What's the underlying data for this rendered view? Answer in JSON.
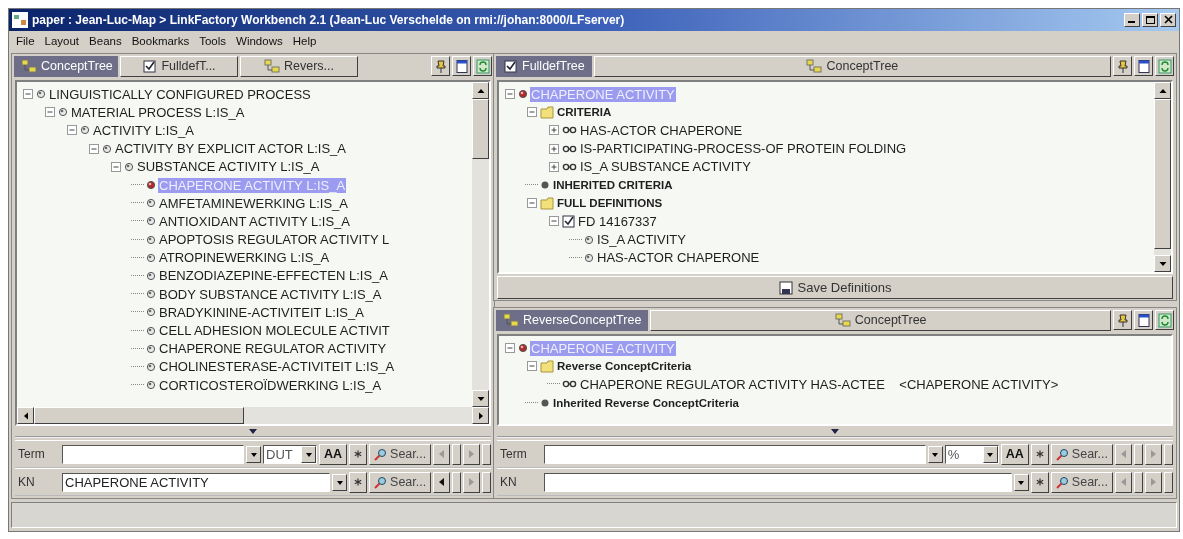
{
  "window": {
    "title": "paper : Jean-Luc-Map > LinkFactory Workbench 2.1 (Jean-Luc Verschelde on rmi://johan:8000/LFserver)"
  },
  "menu": [
    "File",
    "Layout",
    "Beans",
    "Bookmarks",
    "Tools",
    "Windows",
    "Help"
  ],
  "panels": [
    {
      "tabs": [
        {
          "label": "ConceptTree",
          "kind": "tree",
          "selected": true
        },
        {
          "label": "FulldefT...",
          "kind": "definition",
          "selected": false
        },
        {
          "label": "Revers...",
          "kind": "tree",
          "selected": false
        }
      ],
      "tree": [
        {
          "label": "LINGUISTICALLY CONFIGURED PROCESS",
          "kind": "concept",
          "selected": false,
          "expanded": true,
          "children": [
            {
              "label": "MATERIAL PROCESS L:IS_A",
              "kind": "concept",
              "selected": false,
              "expanded": true,
              "children": [
                {
                  "label": "ACTIVITY L:IS_A",
                  "kind": "concept",
                  "selected": false,
                  "expanded": true,
                  "children": [
                    {
                      "label": "ACTIVITY BY EXPLICIT ACTOR L:IS_A",
                      "kind": "concept",
                      "selected": false,
                      "expanded": true,
                      "children": [
                        {
                          "label": "SUBSTANCE ACTIVITY L:IS_A",
                          "kind": "concept",
                          "selected": false,
                          "expanded": true,
                          "children": [
                            {
                              "label": "CHAPERONE ACTIVITY L:IS_A",
                              "kind": "concept",
                              "selected": true
                            },
                            {
                              "label": "AMFETAMINEWERKING L:IS_A",
                              "kind": "concept",
                              "selected": false
                            },
                            {
                              "label": "ANTIOXIDANT ACTIVITY L:IS_A",
                              "kind": "concept",
                              "selected": false
                            },
                            {
                              "label": "APOPTOSIS REGULATOR ACTIVITY L",
                              "kind": "concept",
                              "selected": false
                            },
                            {
                              "label": "ATROPINEWERKING L:IS_A",
                              "kind": "concept",
                              "selected": false
                            },
                            {
                              "label": "BENZODIAZEPINE-EFFECTEN L:IS_A",
                              "kind": "concept",
                              "selected": false
                            },
                            {
                              "label": "BODY SUBSTANCE ACTIVITY L:IS_A",
                              "kind": "concept",
                              "selected": false
                            },
                            {
                              "label": "BRADYKININE-ACTIVITEIT L:IS_A",
                              "kind": "concept",
                              "selected": false
                            },
                            {
                              "label": "CELL ADHESION MOLECULE ACTIVIT",
                              "kind": "concept",
                              "selected": false
                            },
                            {
                              "label": "CHAPERONE REGULATOR ACTIVITY",
                              "kind": "concept",
                              "selected": false
                            },
                            {
                              "label": "CHOLINESTERASE-ACTIVITEIT L:IS_A",
                              "kind": "concept",
                              "selected": false
                            },
                            {
                              "label": "CORTICOSTEROÏDWERKING L:IS_A",
                              "kind": "concept",
                              "selected": false
                            }
                          ]
                        }
                      ]
                    }
                  ]
                }
              ]
            }
          ]
        }
      ],
      "search": [
        {
          "label": "Term",
          "language": "DUT",
          "case_button": "AA",
          "search_button": "Sear...",
          "back_enabled": false
        },
        {
          "label": "KN",
          "value": "CHAPERONE ACTIVITY",
          "search_button": "Sear...",
          "back_enabled": true
        }
      ]
    },
    {
      "tabs": [
        {
          "label": "FulldefTree",
          "kind": "definition",
          "selected": true
        },
        {
          "label": "ConceptTree",
          "kind": "tree",
          "selected": false
        }
      ],
      "tree": [
        {
          "label": "CHAPERONE ACTIVITY",
          "kind": "concept",
          "selected": true,
          "expanded": true,
          "children": [
            {
              "label": "CRITERIA",
              "kind": "folder",
              "selected": false,
              "expanded": true,
              "children": [
                {
                  "label": "HAS-ACTOR CHAPERONE",
                  "kind": "relation",
                  "selected": false,
                  "expanded": false
                },
                {
                  "label": "IS-PARTICIPATING-PROCESS-OF PROTEIN FOLDING",
                  "kind": "relation",
                  "selected": false,
                  "expanded": false
                },
                {
                  "label": "IS_A SUBSTANCE ACTIVITY",
                  "kind": "relation",
                  "selected": false,
                  "expanded": false
                }
              ]
            },
            {
              "label": "INHERITED CRITERIA",
              "kind": "bullet",
              "selected": false
            },
            {
              "label": "FULL DEFINITIONS",
              "kind": "folder",
              "selected": false,
              "expanded": true,
              "children": [
                {
                  "label": "FD 14167337",
                  "kind": "definition",
                  "selected": false,
                  "expanded": true,
                  "children": [
                    {
                      "label": "IS_A ACTIVITY",
                      "kind": "concept",
                      "selected": false
                    },
                    {
                      "label": "HAS-ACTOR CHAPERONE",
                      "kind": "concept",
                      "selected": false
                    }
                  ]
                }
              ]
            }
          ]
        }
      ],
      "save_button": "Save Definitions"
    },
    {
      "tabs": [
        {
          "label": "ReverseConceptTree",
          "kind": "tree",
          "selected": true
        },
        {
          "label": "ConceptTree",
          "kind": "tree",
          "selected": false
        }
      ],
      "tree": [
        {
          "label": "CHAPERONE ACTIVITY",
          "kind": "concept",
          "selected": true,
          "expanded": true,
          "children": [
            {
              "label": "Reverse ConceptCriteria",
              "kind": "folder",
              "selected": false,
              "expanded": true,
              "children": [
                {
                  "label": "CHAPERONE REGULATOR ACTIVITY HAS-ACTEE    <CHAPERONE ACTIVITY>",
                  "kind": "relation",
                  "selected": false
                }
              ]
            },
            {
              "label": "Inherited Reverse ConceptCriteria",
              "kind": "bullet",
              "selected": false
            }
          ]
        }
      ],
      "search": [
        {
          "label": "Term",
          "language": "%",
          "case_button": "AA",
          "search_button": "Sear...",
          "back_enabled": false
        },
        {
          "label": "KN",
          "search_button": "Sear...",
          "back_enabled": false
        }
      ]
    }
  ]
}
